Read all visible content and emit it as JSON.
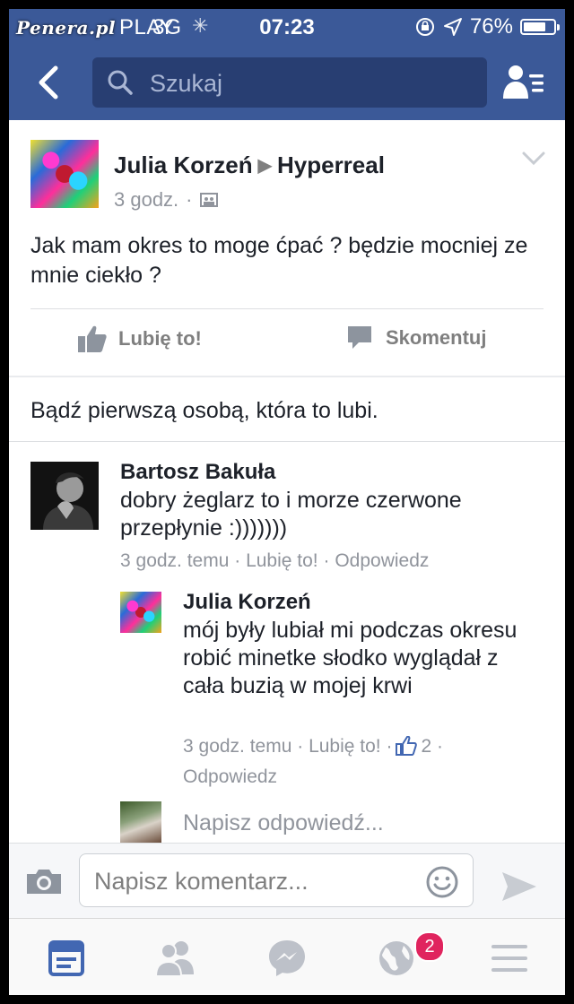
{
  "status_bar": {
    "watermark": "Penera.pl",
    "carrier": "PLAY",
    "network": "3G",
    "time": "07:23",
    "battery": "76%",
    "battery_level": 0.76
  },
  "nav": {
    "search_placeholder": "Szukaj",
    "colors": {
      "brand": "#3b5998",
      "search_bg": "#283e72"
    }
  },
  "post": {
    "author": "Julia Korzeń",
    "target": "Hyperreal",
    "time": "3 godz.",
    "text": "Jak mam okres to moge ćpać ? będzie mocniej ze mnie ciekło ?",
    "like_label": "Lubię to!",
    "comment_label": "Skomentuj",
    "first_like": "Bądź pierwszą osobą, która to lubi."
  },
  "comments": [
    {
      "author": "Bartosz Bakuła",
      "text": "dobry żeglarz to i morze czerwone przepłynie :)))))))",
      "time": "3 godz. temu",
      "like": "Lubię to!",
      "reply": "Odpowiedz"
    },
    {
      "author": "Julia Korzeń",
      "text": "mój były lubiał mi podczas okresu robić minetke słodko wyglądał z cała buzią w mojej krwi",
      "time": "3 godz. temu",
      "like": "Lubię to!",
      "like_count": "2",
      "reply": "Odpowiedz"
    }
  ],
  "reply_placeholder": "Napisz odpowiedź...",
  "composer": {
    "placeholder": "Napisz komentarz..."
  },
  "tabbar": {
    "notifications_badge": "2",
    "active_tab": "news-feed",
    "colors": {
      "active": "#4267b2",
      "inactive": "#bdc1c9",
      "badge": "#e0245e"
    }
  }
}
